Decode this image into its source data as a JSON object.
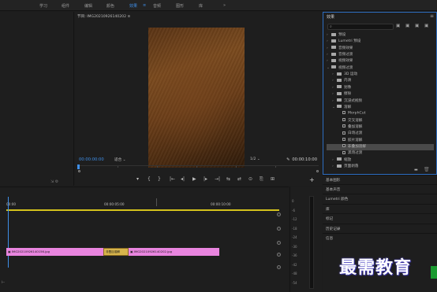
{
  "topbar": {
    "tabs": [
      {
        "label": "学习",
        "active": false
      },
      {
        "label": "组件",
        "active": false
      },
      {
        "label": "编辑",
        "active": false
      },
      {
        "label": "颜色",
        "active": false
      },
      {
        "label": "效果",
        "active": true
      },
      {
        "label": "音频",
        "active": false
      },
      {
        "label": "图形",
        "active": false
      },
      {
        "label": "库",
        "active": false
      }
    ],
    "more": "»"
  },
  "program": {
    "title": "节目: IMG20210926140202 ≡",
    "timecode_current": "00:00:00:00",
    "fit": "适合",
    "resolution": "1/2",
    "timecode_duration": "00:00:10:00"
  },
  "transport": [
    "▾",
    "{",
    "}",
    "|←",
    "◂|",
    "▶",
    "|▸",
    "→|",
    "⇆",
    "⇄",
    "⊙",
    "⎘",
    "⊞"
  ],
  "effects": {
    "title": "效果",
    "menu": "≡",
    "search_placeholder": "",
    "tree": [
      {
        "label": "预设",
        "level": 0,
        "type": "folder",
        "expanded": false
      },
      {
        "label": "Lumetri 预设",
        "level": 0,
        "type": "folder",
        "expanded": false
      },
      {
        "label": "音频效果",
        "level": 0,
        "type": "folder",
        "expanded": false
      },
      {
        "label": "音频过渡",
        "level": 0,
        "type": "folder",
        "expanded": false
      },
      {
        "label": "视频效果",
        "level": 0,
        "type": "folder",
        "expanded": false
      },
      {
        "label": "视频过渡",
        "level": 0,
        "type": "folder",
        "expanded": true
      },
      {
        "label": "3D 运动",
        "level": 1,
        "type": "folder",
        "expanded": false
      },
      {
        "label": "内滑",
        "level": 1,
        "type": "folder",
        "expanded": false
      },
      {
        "label": "划像",
        "level": 1,
        "type": "folder",
        "expanded": false
      },
      {
        "label": "擦除",
        "level": 1,
        "type": "folder",
        "expanded": false
      },
      {
        "label": "沉浸式视频",
        "level": 1,
        "type": "folder",
        "expanded": false
      },
      {
        "label": "溶解",
        "level": 1,
        "type": "folder",
        "expanded": true
      },
      {
        "label": "MorphCut",
        "level": 2,
        "type": "effect"
      },
      {
        "label": "交叉溶解",
        "level": 2,
        "type": "effect"
      },
      {
        "label": "叠加溶解",
        "level": 2,
        "type": "effect"
      },
      {
        "label": "白场过渡",
        "level": 2,
        "type": "effect"
      },
      {
        "label": "胶片溶解",
        "level": 2,
        "type": "effect"
      },
      {
        "label": "非叠加溶解",
        "level": 2,
        "type": "effect",
        "selected": true
      },
      {
        "label": "黑场过渡",
        "level": 2,
        "type": "effect"
      },
      {
        "label": "缩放",
        "level": 1,
        "type": "folder",
        "expanded": false
      },
      {
        "label": "页面剥落",
        "level": 1,
        "type": "folder",
        "expanded": false
      }
    ]
  },
  "right_list": [
    "基本图形",
    "基本声音",
    "Lumetri 颜色",
    "库",
    "标记",
    "历史记录",
    "信息"
  ],
  "timeline": {
    "ruler_labels": [
      "00:00",
      "00:00:05:00",
      "00:00:10:00"
    ],
    "clip1": "IMG20210926140156.jpg",
    "clip2": "IMG20210926140202.jpg",
    "transition": "非叠加溶解"
  },
  "meters": {
    "db_labels": [
      "0",
      "-6",
      "-12",
      "-18",
      "-24",
      "-30",
      "-36",
      "-42",
      "-48",
      "-54"
    ]
  },
  "watermark": "最需教育"
}
